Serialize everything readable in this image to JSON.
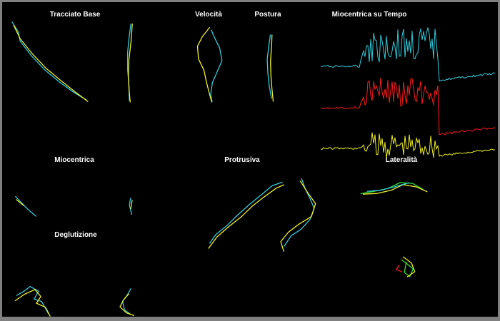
{
  "colors": {
    "background": "#000000",
    "frame": "#808080",
    "cyan": "#33ccdd",
    "yellow": "#f0f02a",
    "red": "#ff1a1a",
    "green": "#33dd33",
    "text": "#ffffff"
  },
  "titles": {
    "tracciato_base": "Tracciato Base",
    "velocita": "Velocità",
    "postura": "Postura",
    "miocentrica_tempo": "Miocentrica su Tempo",
    "miocentrica": "Miocentrica",
    "protrusiva": "Protrusiva",
    "lateralita": "Lateralità",
    "deglutizione": "Deglutizione"
  },
  "chart_data": [
    {
      "type": "line",
      "title": "Tracciato Base",
      "series_colors": [
        "cyan",
        "yellow"
      ],
      "panels": 2
    },
    {
      "type": "line",
      "title": "Velocità",
      "series_colors": [
        "cyan",
        "yellow"
      ],
      "panels": 1
    },
    {
      "type": "line",
      "title": "Postura",
      "series_colors": [
        "cyan",
        "yellow"
      ],
      "panels": 1
    },
    {
      "type": "line",
      "title": "Miocentrica su Tempo",
      "series_colors": [
        "cyan",
        "red",
        "yellow"
      ],
      "axes": "none"
    },
    {
      "type": "line",
      "title": "Miocentrica",
      "series_colors": [
        "cyan",
        "yellow"
      ],
      "panels": 2
    },
    {
      "type": "line",
      "title": "Protrusiva",
      "series_colors": [
        "cyan",
        "yellow"
      ],
      "panels": 2
    },
    {
      "type": "line",
      "title": "Lateralità",
      "series_colors": [
        "green",
        "yellow",
        "cyan",
        "red"
      ],
      "panels": 2
    },
    {
      "type": "line",
      "title": "Deglutizione",
      "series_colors": [
        "cyan",
        "yellow"
      ],
      "panels": 2
    }
  ]
}
